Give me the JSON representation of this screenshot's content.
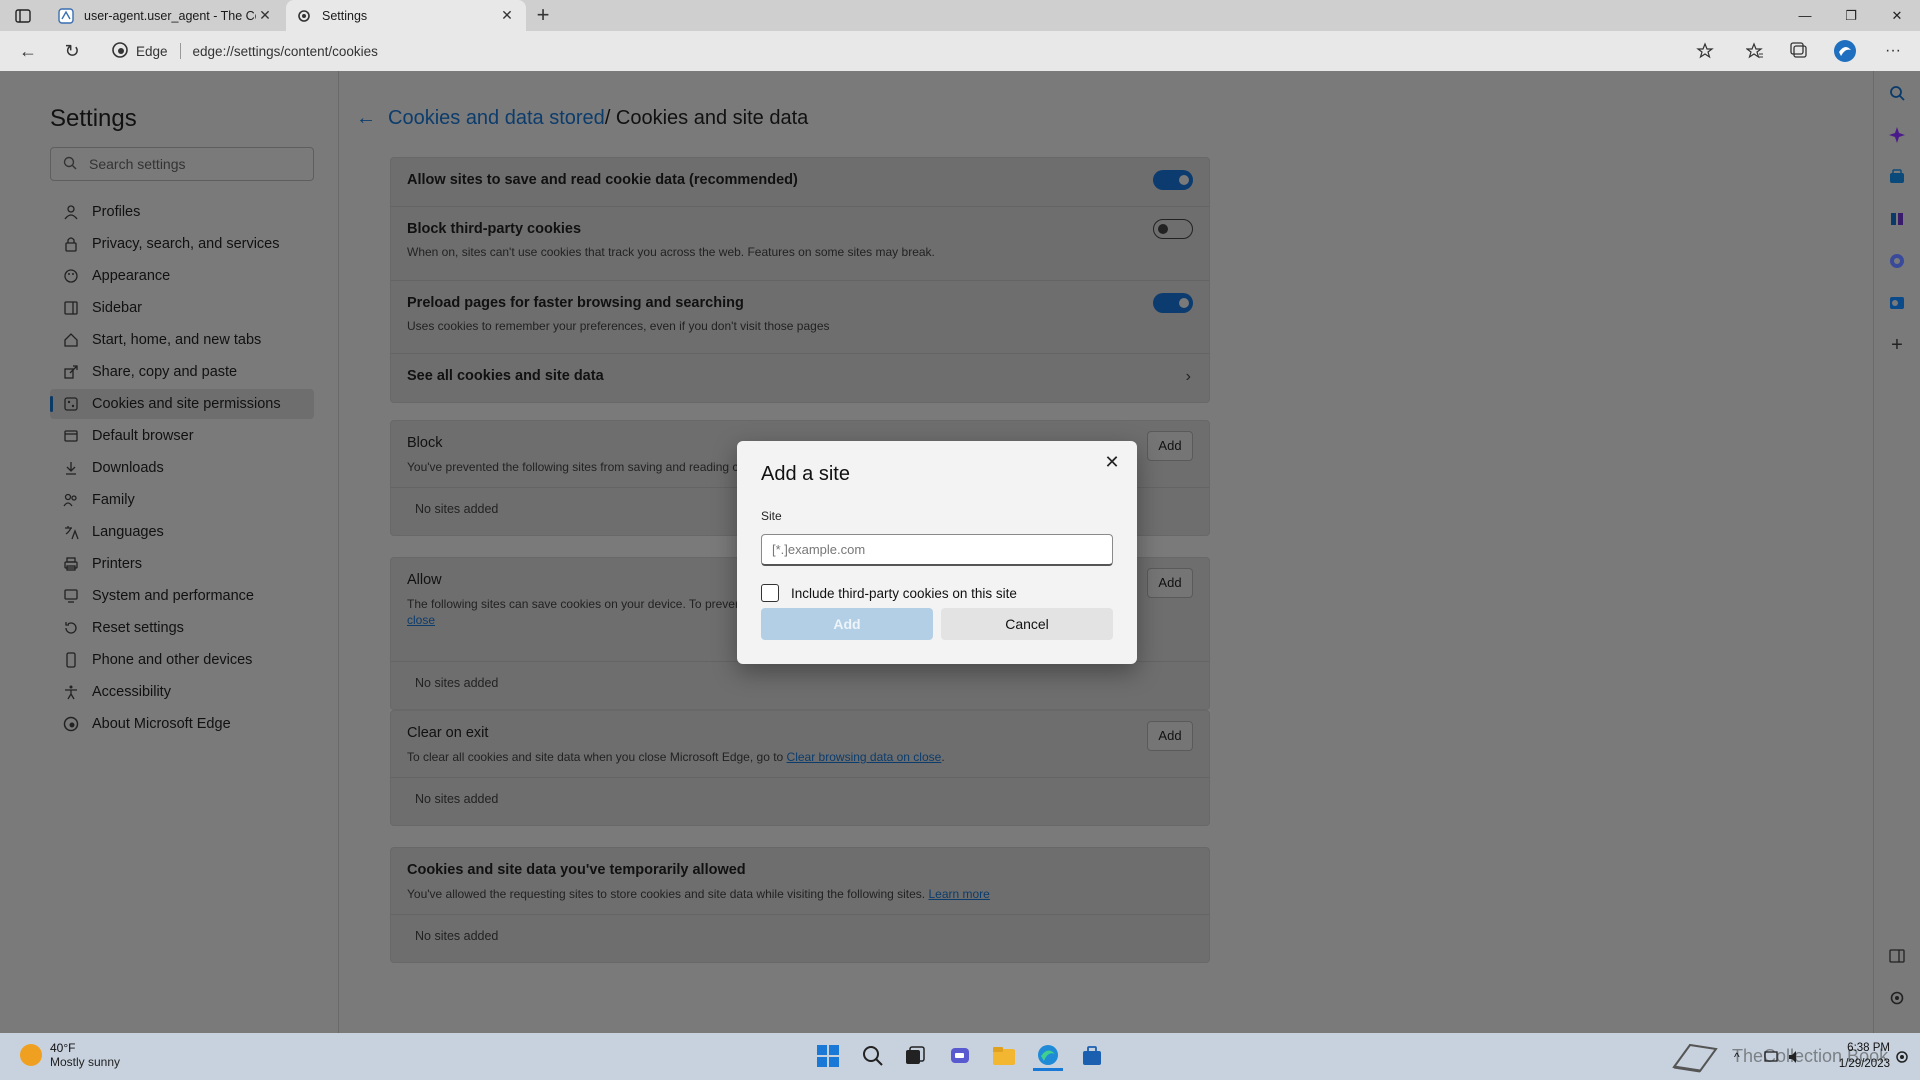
{
  "browser": {
    "tabs": [
      {
        "title": "user-agent.user_agent - The Coll",
        "active": false
      },
      {
        "title": "Settings",
        "active": true
      }
    ],
    "omnibox": {
      "site_label": "Edge",
      "url": "edge://settings/content/cookies"
    }
  },
  "settings": {
    "title": "Settings",
    "search_placeholder": "Search settings",
    "nav": [
      {
        "label": "Profiles",
        "icon": "profile-icon"
      },
      {
        "label": "Privacy, search, and services",
        "icon": "lock-icon"
      },
      {
        "label": "Appearance",
        "icon": "appearance-icon"
      },
      {
        "label": "Sidebar",
        "icon": "sidebar-icon"
      },
      {
        "label": "Start, home, and new tabs",
        "icon": "home-icon"
      },
      {
        "label": "Share, copy and paste",
        "icon": "share-icon"
      },
      {
        "label": "Cookies and site permissions",
        "icon": "cookie-icon",
        "selected": true
      },
      {
        "label": "Default browser",
        "icon": "browser-icon"
      },
      {
        "label": "Downloads",
        "icon": "download-icon"
      },
      {
        "label": "Family",
        "icon": "family-icon"
      },
      {
        "label": "Languages",
        "icon": "languages-icon"
      },
      {
        "label": "Printers",
        "icon": "printer-icon"
      },
      {
        "label": "System and performance",
        "icon": "system-icon"
      },
      {
        "label": "Reset settings",
        "icon": "reset-icon"
      },
      {
        "label": "Phone and other devices",
        "icon": "phone-icon"
      },
      {
        "label": "Accessibility",
        "icon": "accessibility-icon"
      },
      {
        "label": "About Microsoft Edge",
        "icon": "edge-icon"
      }
    ]
  },
  "page": {
    "breadcrumb_link": "Cookies and data stored",
    "breadcrumb_rest": " / Cookies and site data",
    "options": [
      {
        "label": "Allow sites to save and read cookie data (recommended)",
        "desc": "",
        "toggle": "on"
      },
      {
        "label": "Block third-party cookies",
        "desc": "When on, sites can't use cookies that track you across the web. Features on some sites may break.",
        "toggle": "off"
      },
      {
        "label": "Preload pages for faster browsing and searching",
        "desc": "Uses cookies to remember your preferences, even if you don't visit those pages",
        "toggle": "on"
      },
      {
        "label": "See all cookies and site data",
        "desc": "",
        "toggle": "chevron"
      }
    ],
    "block": {
      "label": "Block",
      "desc": "You've prevented the following sites from saving and reading c",
      "add": "Add",
      "empty": "No sites added"
    },
    "allow": {
      "label": "Allow",
      "desc": "The following sites can save cookies on your device. To prevent",
      "desc_link": "close",
      "add": "Add",
      "empty": "No sites added"
    },
    "clear": {
      "label": "Clear on exit",
      "desc": "To clear all cookies and site data when you close Microsoft Edge, go to ",
      "desc_link": "Clear browsing data on close",
      "desc_end": ".",
      "add": "Add",
      "empty": "No sites added"
    },
    "temp": {
      "label": "Cookies and site data you've temporarily allowed",
      "desc": "You've allowed the requesting sites to store cookies and site data while visiting the following sites. ",
      "desc_link": "Learn more",
      "empty": "No sites added"
    }
  },
  "dialog": {
    "title": "Add a site",
    "field_label": "Site",
    "placeholder": "[*.]example.com",
    "checkbox_label": "Include third-party cookies on this site",
    "checkbox_checked": false,
    "add": "Add",
    "cancel": "Cancel"
  },
  "taskbar": {
    "weather_temp": "40°F",
    "weather_desc": "Mostly sunny",
    "time": "6:38 PM",
    "date": "1/29/2023",
    "watermark": "TheCollection Book"
  },
  "colors": {
    "accent": "#0b3b6f",
    "link": "#0c3c6c"
  }
}
